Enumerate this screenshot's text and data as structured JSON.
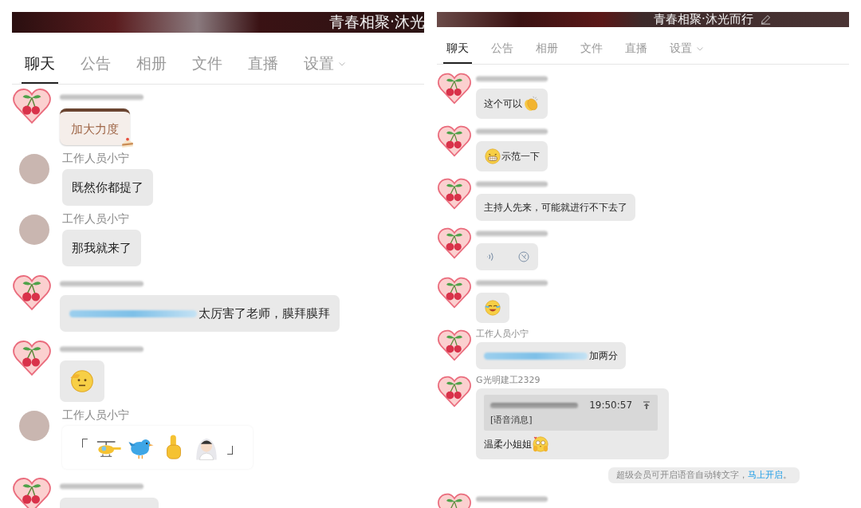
{
  "panels": [
    {
      "title": "青春相聚·沐光",
      "tabs": [
        {
          "label": "聊天",
          "selected": true
        },
        {
          "label": "公告",
          "selected": false
        },
        {
          "label": "相册",
          "selected": false
        },
        {
          "label": "文件",
          "selected": false
        },
        {
          "label": "直播",
          "selected": false
        },
        {
          "label": "设置",
          "selected": false,
          "dropdown": true
        }
      ],
      "messages": [
        {
          "kind": "sticker",
          "avatar": {
            "kind": "heart"
          },
          "name_redacted": true,
          "text": "加大力度"
        },
        {
          "kind": "text",
          "avatar": {
            "kind": "photo"
          },
          "sender": "工作人员小宁",
          "parts": [
            {
              "kind": "text",
              "text": "既然你都提了"
            }
          ]
        },
        {
          "kind": "text",
          "avatar": {
            "kind": "photo"
          },
          "sender": "工作人员小宁",
          "parts": [
            {
              "kind": "text",
              "text": "那我就来了"
            }
          ]
        },
        {
          "kind": "text",
          "avatar": {
            "kind": "heart"
          },
          "name_redacted": true,
          "parts": [
            {
              "kind": "redacted"
            },
            {
              "kind": "text",
              "text": "太厉害了老师，膜拜膜拜"
            }
          ]
        },
        {
          "kind": "text",
          "avatar": {
            "kind": "heart"
          },
          "name_redacted": true,
          "parts": [
            {
              "kind": "salute"
            }
          ]
        },
        {
          "kind": "emoji-card",
          "avatar": {
            "kind": "photo"
          },
          "sender": "工作人员小宁",
          "open": "「",
          "close": "」",
          "emojis": [
            {
              "kind": "helicopter"
            },
            {
              "kind": "bird"
            },
            {
              "kind": "finger"
            },
            {
              "kind": "bride"
            }
          ]
        },
        {
          "kind": "cut",
          "avatar": {
            "kind": "heart"
          },
          "name_redacted": true
        }
      ]
    },
    {
      "title": "青春相聚·沐光而行",
      "edit_icon": true,
      "tabs": [
        {
          "label": "聊天",
          "selected": true
        },
        {
          "label": "公告",
          "selected": false
        },
        {
          "label": "相册",
          "selected": false
        },
        {
          "label": "文件",
          "selected": false
        },
        {
          "label": "直播",
          "selected": false
        },
        {
          "label": "设置",
          "selected": false,
          "dropdown": true
        }
      ],
      "messages": [
        {
          "kind": "text",
          "avatar": {
            "kind": "heart"
          },
          "name_redacted": true,
          "parts": [
            {
              "kind": "text",
              "text": "这个可以"
            },
            {
              "kind": "clap"
            }
          ]
        },
        {
          "kind": "text",
          "avatar": {
            "kind": "heart"
          },
          "name_redacted": true,
          "parts": [
            {
              "kind": "grin"
            },
            {
              "kind": "text",
              "text": "示范一下"
            }
          ]
        },
        {
          "kind": "text",
          "avatar": {
            "kind": "heart"
          },
          "name_redacted": true,
          "parts": [
            {
              "kind": "text",
              "text": "主持人先来，可能就进行不下去了"
            }
          ]
        },
        {
          "kind": "voice",
          "avatar": {
            "kind": "heart"
          },
          "name_redacted": true
        },
        {
          "kind": "text",
          "avatar": {
            "kind": "heart"
          },
          "name_redacted": true,
          "parts": [
            {
              "kind": "laugh-cry"
            }
          ]
        },
        {
          "kind": "text",
          "avatar": {
            "kind": "heart"
          },
          "sender": "工作人员小宁",
          "parts": [
            {
              "kind": "redacted"
            },
            {
              "kind": "text",
              "text": "加两分"
            }
          ]
        },
        {
          "kind": "reply",
          "avatar": {
            "kind": "heart"
          },
          "sender": "G光明建工2329",
          "quote": {
            "time": "19:50:57",
            "label": "[语音消息]"
          },
          "parts": [
            {
              "kind": "text",
              "text": "温柔小姐姐"
            },
            {
              "kind": "adore"
            }
          ]
        },
        {
          "kind": "system",
          "text": "超级会员可开启语音自动转文字，",
          "link": "马上开启",
          "end": "。"
        },
        {
          "kind": "cut",
          "avatar": {
            "kind": "heart"
          },
          "name_redacted": true
        }
      ]
    }
  ]
}
